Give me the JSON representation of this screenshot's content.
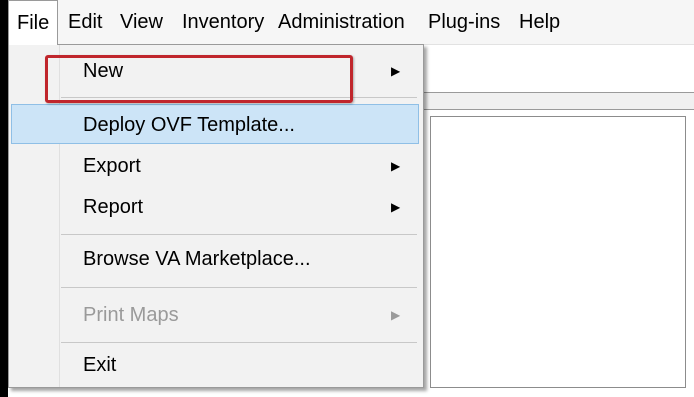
{
  "menubar": {
    "items": [
      {
        "label": "File",
        "open": true
      },
      {
        "label": "Edit"
      },
      {
        "label": "View"
      },
      {
        "label": "Inventory"
      },
      {
        "label": "Administration"
      },
      {
        "label": "Plug-ins"
      },
      {
        "label": "Help"
      }
    ]
  },
  "file_menu": {
    "items": [
      {
        "label": "New",
        "submenu": true,
        "enabled": true
      },
      {
        "label": "Deploy OVF Template...",
        "submenu": false,
        "enabled": true,
        "highlighted": true
      },
      {
        "label": "Export",
        "submenu": true,
        "enabled": true
      },
      {
        "label": "Report",
        "submenu": true,
        "enabled": true
      },
      {
        "label": "Browse VA Marketplace...",
        "submenu": false,
        "enabled": true
      },
      {
        "label": "Print Maps",
        "submenu": true,
        "enabled": false
      },
      {
        "label": "Exit",
        "submenu": false,
        "enabled": true
      }
    ],
    "submenu_arrow": "▶"
  },
  "colors": {
    "highlight": "#cce4f7",
    "callout": "#c0262c",
    "disabled_text": "#9a9a9a"
  },
  "icons": {
    "submenu": "chevron-right-icon"
  }
}
